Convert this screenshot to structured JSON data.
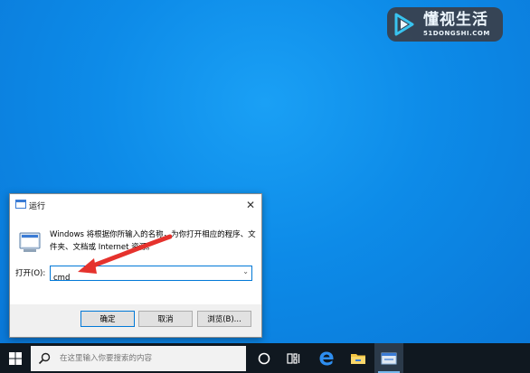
{
  "watermark": {
    "brand_cn": "懂视生活",
    "brand_en": "51DONGSHI.COM"
  },
  "dialog": {
    "title": "运行",
    "close_glyph": "✕",
    "description": "Windows 将根据你所输入的名称，为你打开相应的程序、文件夹、文档或 Internet 资源。",
    "open_label": "打开(O):",
    "input_value": "cmd",
    "dropdown_glyph": "⌄",
    "ok_label": "确定",
    "cancel_label": "取消",
    "browse_label": "浏览(B)...",
    "accent": "#0078d7"
  },
  "annotation": {
    "arrow_color": "#e5322d"
  },
  "taskbar": {
    "search_placeholder": "在这里输入你要搜索的内容",
    "icons": [
      "windows-start-icon",
      "cortana-icon",
      "task-view-icon",
      "edge-icon",
      "file-explorer-icon",
      "run-app-icon"
    ]
  }
}
